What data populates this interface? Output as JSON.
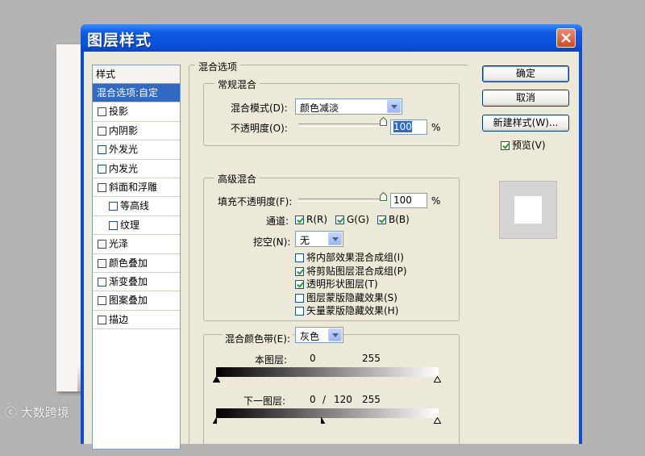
{
  "dialog": {
    "title": "图层样式"
  },
  "styles": {
    "header": "样式",
    "items": [
      {
        "label": "混合选项:自定",
        "selected": true,
        "checkbox": false,
        "sub": false
      },
      {
        "label": "投影",
        "checkbox": true,
        "checked": false,
        "sub": false
      },
      {
        "label": "内阴影",
        "checkbox": true,
        "checked": false,
        "sub": false
      },
      {
        "label": "外发光",
        "checkbox": true,
        "checked": false,
        "sub": false
      },
      {
        "label": "内发光",
        "checkbox": true,
        "checked": false,
        "sub": false
      },
      {
        "label": "斜面和浮雕",
        "checkbox": true,
        "checked": false,
        "sub": false
      },
      {
        "label": "等高线",
        "checkbox": true,
        "checked": false,
        "sub": true
      },
      {
        "label": "纹理",
        "checkbox": true,
        "checked": false,
        "sub": true
      },
      {
        "label": "光泽",
        "checkbox": true,
        "checked": false,
        "sub": false
      },
      {
        "label": "颜色叠加",
        "checkbox": true,
        "checked": false,
        "sub": false
      },
      {
        "label": "渐变叠加",
        "checkbox": true,
        "checked": false,
        "sub": false
      },
      {
        "label": "图案叠加",
        "checkbox": true,
        "checked": false,
        "sub": false
      },
      {
        "label": "描边",
        "checkbox": true,
        "checked": false,
        "sub": false
      }
    ]
  },
  "blend_options": {
    "group_title": "混合选项",
    "general": {
      "title": "常规混合",
      "mode_label": "混合模式(D):",
      "mode_value": "颜色减淡",
      "opacity_label": "不透明度(O):",
      "opacity_value": "100",
      "unit": "%"
    },
    "advanced": {
      "title": "高级混合",
      "fill_label": "填充不透明度(F):",
      "fill_value": "100",
      "unit": "%",
      "channels_label": "通道:",
      "channels": [
        {
          "label": "R(R)",
          "checked": true
        },
        {
          "label": "G(G)",
          "checked": true
        },
        {
          "label": "B(B)",
          "checked": true
        }
      ],
      "knockout_label": "挖空(N):",
      "knockout_value": "无",
      "options": [
        {
          "label": "将内部效果混合成组(I)",
          "checked": false
        },
        {
          "label": "将剪贴图层混合成组(P)",
          "checked": true
        },
        {
          "label": "透明形状图层(T)",
          "checked": true
        },
        {
          "label": "图层蒙版隐藏效果(S)",
          "checked": false
        },
        {
          "label": "矢量蒙版隐藏效果(H)",
          "checked": false
        }
      ]
    },
    "blend_if": {
      "label": "混合颜色带(E):",
      "value": "灰色",
      "this_layer_label": "本图层:",
      "this_layer_low": "0",
      "this_layer_high": "255",
      "underlying_label": "下一图层:",
      "underlying_low": "0",
      "underlying_sep": "/",
      "underlying_mid": "120",
      "underlying_high": "255"
    }
  },
  "buttons": {
    "ok": "确定",
    "cancel": "取消",
    "new_style": "新建样式(W)...",
    "preview": "预览(V)",
    "preview_checked": true
  },
  "watermark": "大数跨境"
}
